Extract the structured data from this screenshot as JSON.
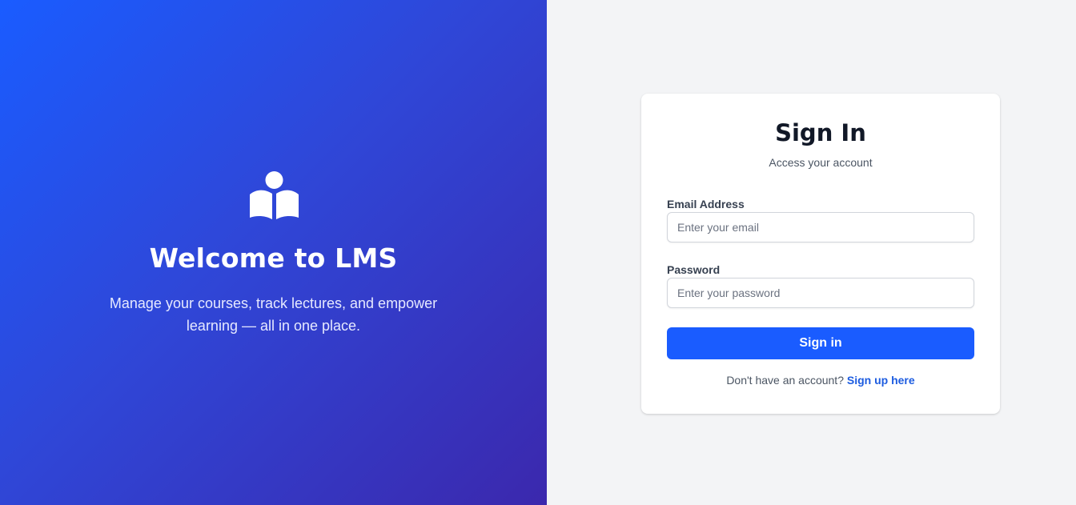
{
  "hero": {
    "icon": "book-reader-icon",
    "title": "Welcome to LMS",
    "subtitle_line1": "Manage your courses, track lectures, and empower",
    "subtitle_line2": "learning — all in one place."
  },
  "signin": {
    "title": "Sign In",
    "subtitle": "Access your account",
    "email_label": "Email Address",
    "email_placeholder": "Enter your email",
    "email_value": "",
    "password_label": "Password",
    "password_placeholder": "Enter your password",
    "password_value": "",
    "button_label": "Sign in",
    "signup_prompt": "Don't have an account?",
    "signup_link": "Sign up here"
  },
  "colors": {
    "accent": "#1a5cff",
    "hero_gradient_start": "#1a5cff",
    "hero_gradient_end": "#3b28ad",
    "page_background": "#f3f4f6",
    "link": "#1d5ce0"
  }
}
